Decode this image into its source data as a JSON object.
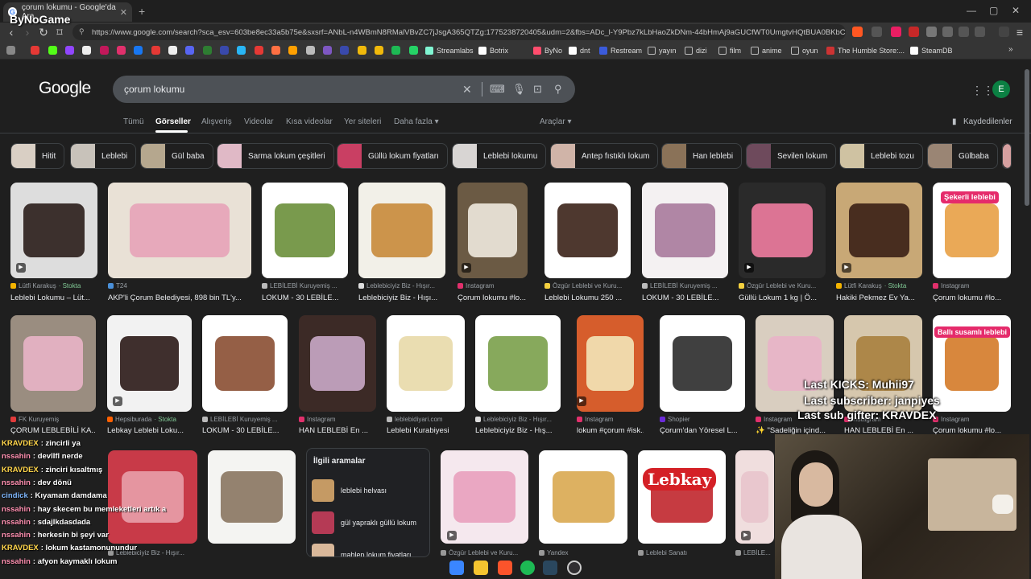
{
  "browser": {
    "tab_title": "çorum lokumu - Google'da Ara",
    "new_tab": "+",
    "url": "https://www.google.com/search?sca_esv=603be8ec33a5b75e&sxsrf=ANbL-n4WBmN8RMalVBvZC7jJsgA365QTZg:1775238720405&udm=2&fbs=ADc_l-Y9Pbz7kLbHaoZkDNm-44bHmAj9aGUCfWT0UmgtvHQtBUA0BKbC...",
    "bookmarks": [
      {
        "label": "Streamlabs",
        "color": "#80f5d2"
      },
      {
        "label": "Botrix",
        "color": "#ffffff"
      },
      {
        "label": "ByNo",
        "color": "#ff4d6d"
      },
      {
        "label": "dnt",
        "color": "#ffffff"
      },
      {
        "label": "Restream",
        "color": "#3b5bdb"
      },
      {
        "label": "yayın",
        "color": "#bbbbbb"
      },
      {
        "label": "dizi",
        "color": "#bbbbbb"
      },
      {
        "label": "film",
        "color": "#bbbbbb"
      },
      {
        "label": "anime",
        "color": "#bbbbbb"
      },
      {
        "label": "oyun",
        "color": "#bbbbbb"
      },
      {
        "label": "The Humble Store:...",
        "color": "#cc3333"
      },
      {
        "label": "SteamDB",
        "color": "#ffffff"
      }
    ]
  },
  "google": {
    "logo": "Google",
    "query": "çorum lokumu",
    "avatar_letter": "E",
    "tabs": [
      "Tümü",
      "Görseller",
      "Alışveriş",
      "Videolar",
      "Kısa videolar",
      "Yer siteleri",
      "Daha fazla ▾"
    ],
    "tools": "Araçlar ▾",
    "saved": "Kaydedilenler",
    "chips": [
      {
        "label": "Hitit",
        "color": "#d9cfc4"
      },
      {
        "label": "Leblebi",
        "color": "#c8c2ba"
      },
      {
        "label": "Gül baba",
        "color": "#b5a78e"
      },
      {
        "label": "Sarma lokum çeşitleri",
        "color": "#e0b9c6"
      },
      {
        "label": "Güllü lokum fiyatları",
        "color": "#c93f63"
      },
      {
        "label": "Leblebi lokumu",
        "color": "#d8d5d3"
      },
      {
        "label": "Antep fıstıklı lokum",
        "color": "#d0b4a8"
      },
      {
        "label": "Han leblebi",
        "color": "#8a7258"
      },
      {
        "label": "Sevilen lokum",
        "color": "#6e4a5c"
      },
      {
        "label": "Leblebi tozu",
        "color": "#cfc2a2"
      },
      {
        "label": "Gülbaba",
        "color": "#9a8574"
      }
    ],
    "row1": [
      {
        "source": "Lütfi Karakuş",
        "stock": "· Stokta",
        "title": "Leblebi Lokumu – Lüt...",
        "icon": "#f4b400",
        "bg": "#dddddd",
        "accent": "#2a1d1a"
      },
      {
        "source": "T24",
        "stock": "",
        "title": "AKP'li Çorum Belediyesi, 898 bin TL'y...",
        "icon": "#4a90d9",
        "bg": "#e9e1d6",
        "accent": "#e7a3b8"
      },
      {
        "source": "LEBİLEBİ Kuruyemiş ...",
        "stock": "",
        "title": "LOKUM - 30 LEBİLE...",
        "icon": "#bbbbbb",
        "bg": "#ffffff",
        "accent": "#6a8f3a"
      },
      {
        "source": "Leblebiciyiz Biz - Hışır...",
        "stock": "",
        "title": "Leblebiciyiz Biz - Hışı...",
        "icon": "#dddddd",
        "bg": "#f2f0e8",
        "accent": "#c88a3a"
      },
      {
        "source": "Instagram",
        "stock": "",
        "title": "Çorum lokumu #lo...",
        "icon": "#e1306c",
        "bg": "#6b5a44",
        "accent": "#efe9df"
      },
      {
        "source": "Özgür Leblebi ve Kuru...",
        "stock": "",
        "title": "Leblebi Lokumu 250 ...",
        "icon": "#f4d03f",
        "bg": "#ffffff",
        "accent": "#3b2218"
      },
      {
        "source": "LEBİLEBİ Kuruyemiş ...",
        "stock": "",
        "title": "LOKUM - 30 LEBİLE...",
        "icon": "#bbbbbb",
        "bg": "#f4f1f2",
        "accent": "#a87a9c"
      },
      {
        "source": "Özgür Leblebi ve Kuru...",
        "stock": "",
        "title": "Güllü Lokum 1 kg | Ö...",
        "icon": "#f4d03f",
        "bg": "#2a2a2a",
        "accent": "#f07ca0"
      },
      {
        "source": "Lütfi Karakuş",
        "stock": "· Stokta",
        "title": "Hakiki Pekmez Ev Ya...",
        "icon": "#f4b400",
        "bg": "#c8a876",
        "accent": "#3a1f16"
      },
      {
        "source": "Instagram",
        "stock": "",
        "title": "Çorum lokumu #lo...",
        "icon": "#e1306c",
        "bg": "#ffffff",
        "accent": "#e8a045"
      }
    ],
    "row2": [
      {
        "source": "FK Kuruyemiş",
        "stock": "",
        "title": "ÇORUM LEBLEBİLİ KA...",
        "icon": "#e23b3b",
        "bg": "#9a8d80",
        "accent": "#e9b4c7"
      },
      {
        "source": "Hepsiburada",
        "stock": "· Stokta",
        "title": "Lebkay Leblebi Loku...",
        "icon": "#ff6000",
        "bg": "#f2f2f2",
        "accent": "#2b1a17"
      },
      {
        "source": "LEBİLEBİ Kuruyemiş ...",
        "stock": "",
        "title": "LOKUM - 30 LEBİLE...",
        "icon": "#bbbbbb",
        "bg": "#ffffff",
        "accent": "#8a4e32"
      },
      {
        "source": "Instagram",
        "stock": "",
        "title": "HAN LEBLEBİ En ...",
        "icon": "#e1306c",
        "bg": "#3c2a26",
        "accent": "#c9a8c8"
      },
      {
        "source": "leblebidiyari.com",
        "stock": "",
        "title": "Leblebi Kurabiyesi",
        "icon": "#bbbbbb",
        "bg": "#ffffff",
        "accent": "#e8d9a8"
      },
      {
        "source": "Leblebiciyiz Biz - Hışır...",
        "stock": "",
        "title": "Leblebiciyiz Biz - Hış...",
        "icon": "#dddddd",
        "bg": "#ffffff",
        "accent": "#7aa04a"
      },
      {
        "source": "Instagram",
        "stock": "",
        "title": "lokum #çorum #isk...",
        "icon": "#e1306c",
        "bg": "#d65d2c",
        "accent": "#f3e6b8"
      },
      {
        "source": "Shopier",
        "stock": "",
        "title": "Çorum'dan Yöresel L...",
        "icon": "#6c2bd9",
        "bg": "#ffffff",
        "accent": "#2b2b2b"
      },
      {
        "source": "Instagram",
        "stock": "",
        "title": "✨ \"Sadeliğin içind...",
        "icon": "#e1306c",
        "bg": "#d9cec0",
        "accent": "#e8b4c8"
      },
      {
        "source": "Instagram",
        "stock": "",
        "title": "HAN LEBLEBİ En ...",
        "icon": "#e1306c",
        "bg": "#d6c7ad",
        "accent": "#a8803e"
      },
      {
        "source": "Instagram",
        "stock": "",
        "title": "Çorum lokumu #lo...",
        "icon": "#e1306c",
        "bg": "#ffffff",
        "accent": "#d47a28"
      }
    ],
    "row3": [
      {
        "source": "Leblebiciyiz Biz - Hışır...",
        "title": "",
        "bg": "#c83a48",
        "accent": "#e8a0aa"
      },
      {
        "source": "",
        "title": "",
        "bg": "#f4f4f2",
        "accent": "#8a7660"
      },
      {
        "source": "Özgür Leblebi ve Kuru...",
        "title": "",
        "bg": "#f5e8ee",
        "accent": "#e9a0bc"
      },
      {
        "source": "Yandex",
        "title": "",
        "bg": "#ffffff",
        "accent": "#d9a850"
      },
      {
        "source": "Leblebi Sanatı",
        "title": "",
        "bg": "#ffffff",
        "accent": "#c0262c"
      },
      {
        "source": "LEBİLE...",
        "title": "",
        "bg": "#f0dede",
        "accent": "#e8c4cc"
      }
    ],
    "badges": {
      "b1": "Şekerli leblebi",
      "b2": "Ballı susamlı leblebi",
      "lebkay": "Lebkay"
    },
    "related": {
      "header": "İlgili aramalar",
      "items": [
        "leblebi helvası",
        "gül yapraklı güllü lokum",
        "mahlep lokum fiyatları"
      ]
    }
  },
  "stream": {
    "channel_logo": "ByNoGame",
    "last_kicks": "Last KICKS: Muhii97",
    "last_sub": "Last subscriber: janpiyes",
    "last_gifter": "Last sub gifter: KRAVDEX",
    "chat": [
      {
        "name": "KRAVDEX",
        "color": "#ffd54a",
        "msg": ": zincirli ya"
      },
      {
        "name": "nssahin",
        "color": "#ff8fb0",
        "msg": ": devlIfl nerde"
      },
      {
        "name": "KRAVDEX",
        "color": "#ffd54a",
        "msg": ": zinciri kısaltmış"
      },
      {
        "name": "nssahin",
        "color": "#ff8fb0",
        "msg": ": dev dönü"
      },
      {
        "name": "cindick",
        "color": "#7fb8ff",
        "msg": ": Kıyamam damdama"
      },
      {
        "name": "nssahin",
        "color": "#ff8fb0",
        "msg": ": hay skecem bu memleketleri artık a"
      },
      {
        "name": "nssahin",
        "color": "#ff8fb0",
        "msg": ": sdajlkdasdada"
      },
      {
        "name": "nssahin",
        "color": "#ff8fb0",
        "msg": ": herkesin bi şeyi var"
      },
      {
        "name": "KRAVDEX",
        "color": "#ffd54a",
        "msg": ": lokum kastamonunundur"
      },
      {
        "name": "nssahin",
        "color": "#ff8fb0",
        "msg": ": afyon kaymaklı lokum"
      }
    ]
  },
  "taskbar": {
    "icons": [
      "windows-icon",
      "file-explorer-icon",
      "brave-icon",
      "spotify-icon",
      "steam-icon",
      "obs-icon"
    ]
  }
}
